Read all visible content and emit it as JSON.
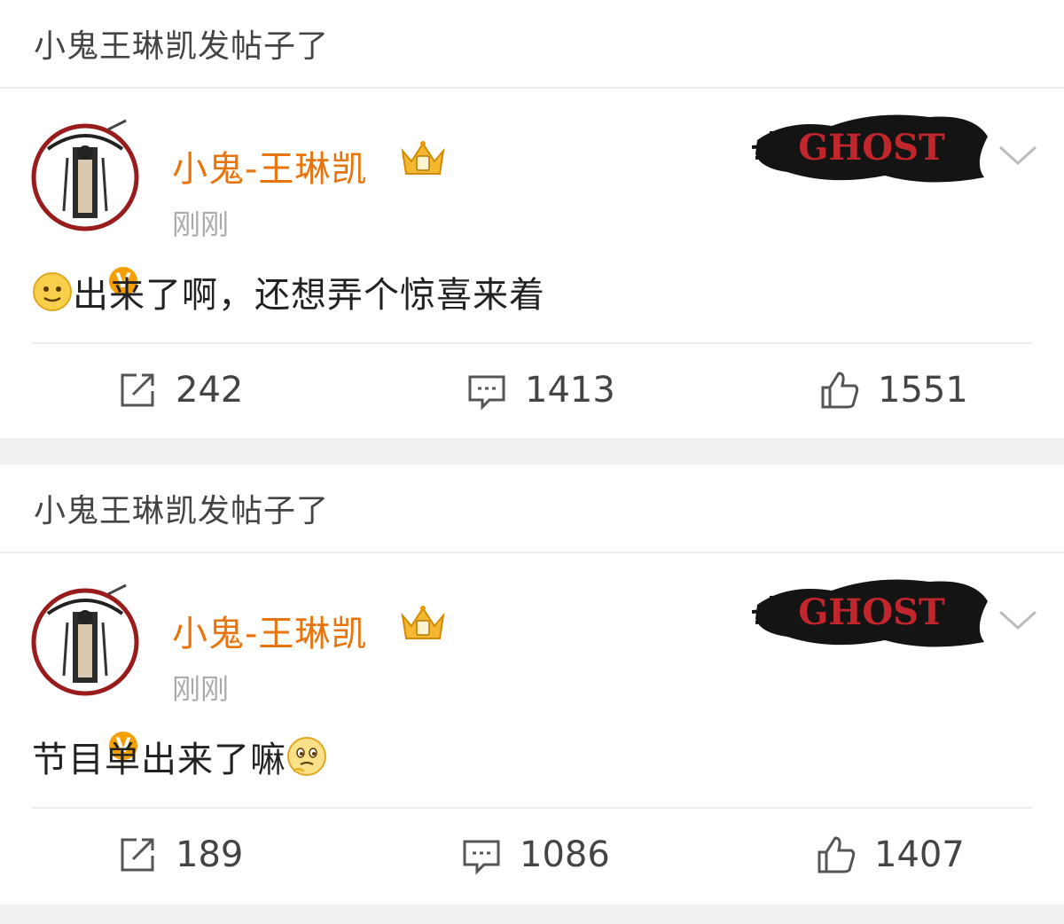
{
  "posts": [
    {
      "header": "小鬼王琳凯发帖子了",
      "username": "小鬼-王琳凯",
      "time": "刚刚",
      "content": "出来了啊，还想弄个惊喜来着",
      "emoji": "smile-emoji",
      "banner_text": "GHOST",
      "verified_badge": "V",
      "repost_count": "242",
      "comment_count": "1413",
      "like_count": "1551"
    },
    {
      "header": "小鬼王琳凯发帖子了",
      "username": "小鬼-王琳凯",
      "time": "刚刚",
      "content": "节目单出来了嘛",
      "emoji": "thinking-emoji",
      "banner_text": "GHOST",
      "verified_badge": "V",
      "repost_count": "189",
      "comment_count": "1086",
      "like_count": "1407"
    }
  ],
  "colors": {
    "username": "#e8740d",
    "badge": "#f5a000",
    "banner_text": "#c0262c",
    "icon": "#555555"
  }
}
